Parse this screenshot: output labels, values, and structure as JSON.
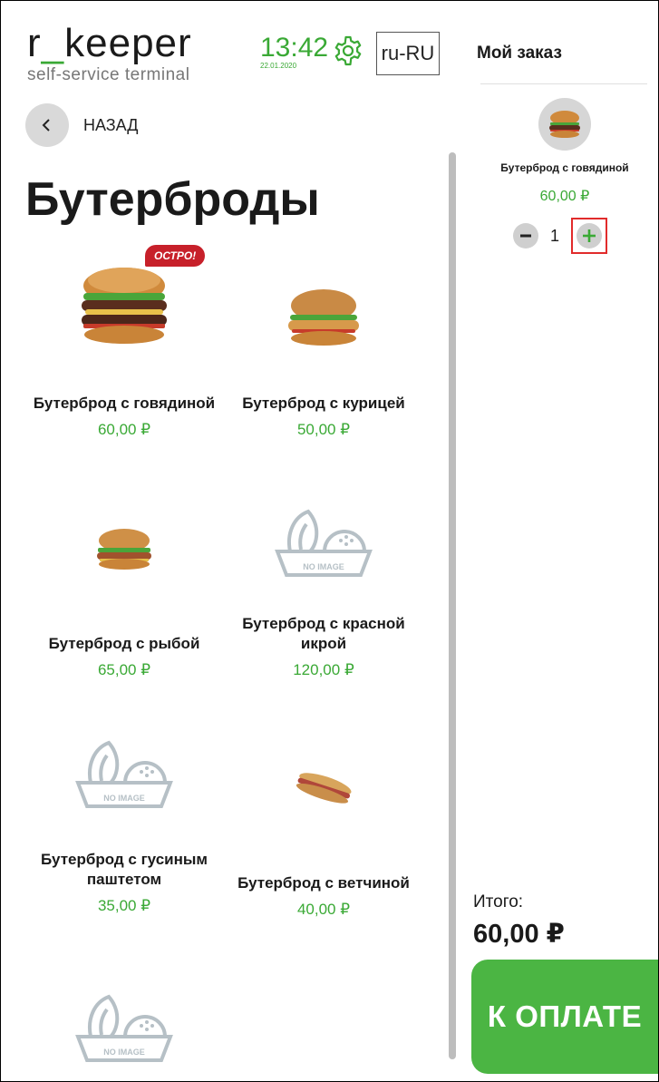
{
  "header": {
    "logo_main_a": "r",
    "logo_main_b": "_",
    "logo_main_c": "keeper",
    "logo_sub": "self-service terminal",
    "time": "13:42",
    "date": "22.01.2020",
    "settings_icon": "gear-icon",
    "language": "ru-RU"
  },
  "nav": {
    "back_label": "НАЗАД",
    "back_icon": "chevron-left-icon"
  },
  "category": {
    "title": "Бутерброды"
  },
  "products": [
    {
      "name": "Бутерброд с говядиной",
      "price": "60,00 ₽",
      "badge": "ОСТРО!",
      "image": "beef-burger"
    },
    {
      "name": "Бутерброд с курицей",
      "price": "50,00 ₽",
      "image": "chicken-burger"
    },
    {
      "name": "Бутерброд с рыбой",
      "price": "65,00 ₽",
      "image": "fish-burger"
    },
    {
      "name": "Бутерброд с красной икрой",
      "price": "120,00 ₽",
      "image": "no-image",
      "no_image_text": "NO IMAGE"
    },
    {
      "name": "Бутерброд с гусиным паштетом",
      "price": "35,00 ₽",
      "image": "no-image",
      "no_image_text": "NO IMAGE"
    },
    {
      "name": "Бутерброд с ветчиной",
      "price": "40,00 ₽",
      "image": "ham-sandwich"
    },
    {
      "image": "no-image",
      "no_image_text": "NO IMAGE"
    }
  ],
  "order": {
    "title": "Мой заказ",
    "items": [
      {
        "name": "Бутерброд с говядиной",
        "price": "60,00 ₽",
        "quantity": "1"
      }
    ],
    "total_label": "Итого:",
    "total_value": "60,00 ₽",
    "pay_label": "К ОПЛАТЕ"
  },
  "colors": {
    "accent_green": "#3aa935",
    "button_green": "#4bb543",
    "badge_red": "#c7202a",
    "highlight_red": "#e12b2b"
  }
}
